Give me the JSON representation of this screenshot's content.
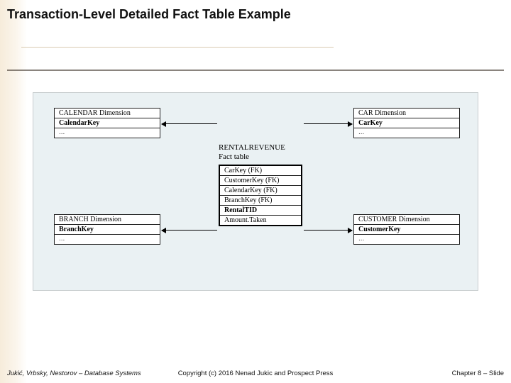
{
  "title": "Transaction-Level Detailed Fact Table Example",
  "diagram": {
    "dims": {
      "calendar": {
        "title": "CALENDAR Dimension",
        "key": "CalendarKey",
        "more": "..."
      },
      "car": {
        "title": "CAR Dimension",
        "key": "CarKey",
        "more": "..."
      },
      "branch": {
        "title": "BRANCH Dimension",
        "key": "BranchKey",
        "more": "..."
      },
      "customer": {
        "title": "CUSTOMER Dimension",
        "key": "CustomerKey",
        "more": "..."
      }
    },
    "fact": {
      "label1": "RENTALREVENUE",
      "label2": "Fact table",
      "rows": {
        "r0": "CarKey (FK)",
        "r1": "CustomerKey (FK)",
        "r2": "CalendarKey (FK)",
        "r3": "BranchKey (FK)",
        "r4": "RentalTID",
        "r5": "Amount.Taken"
      }
    }
  },
  "footer": {
    "left": "Jukić, Vrbsky, Nestorov – Database Systems",
    "center": "Copyright (c) 2016 Nenad Jukic and Prospect Press",
    "right": "Chapter 8 – Slide"
  }
}
